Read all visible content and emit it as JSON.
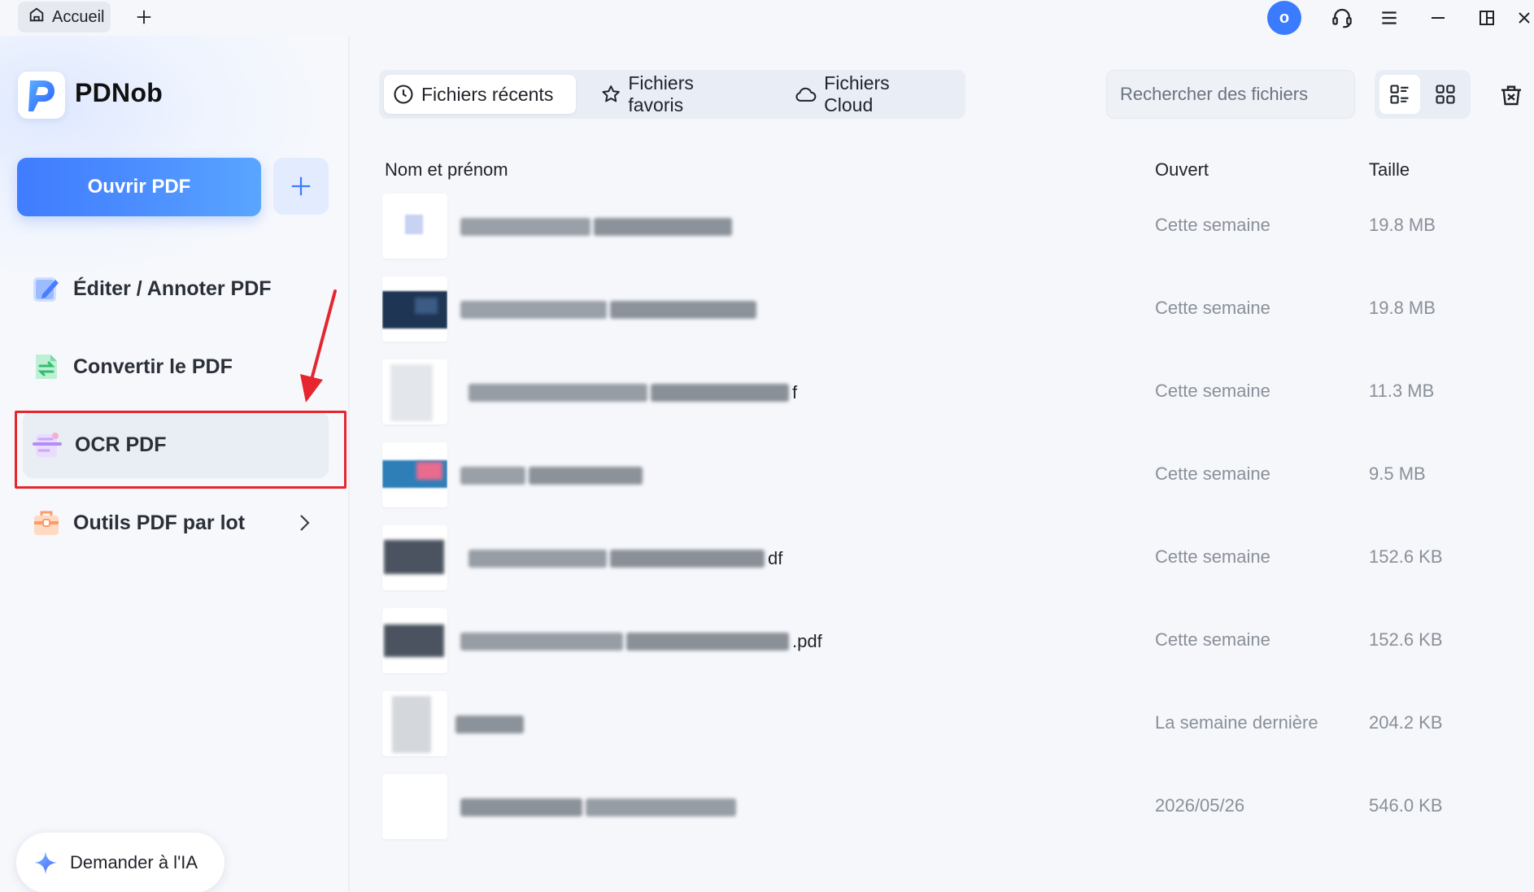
{
  "titlebar": {
    "home_tab": "Accueil",
    "avatar_letter": "o",
    "icons": [
      "home-icon",
      "plus-icon",
      "headset-icon",
      "menu-icon",
      "minimize-icon",
      "restore-icon",
      "close-icon"
    ]
  },
  "sidebar": {
    "app_name": "PDNob",
    "open_button": "Ouvrir PDF",
    "items": [
      {
        "label": "Éditer / Annoter PDF",
        "icon": "edit-icon"
      },
      {
        "label": "Convertir le PDF",
        "icon": "convert-icon"
      },
      {
        "label": "OCR PDF",
        "icon": "ocr-icon",
        "active": true
      },
      {
        "label": "Outils PDF par lot",
        "icon": "batch-icon"
      }
    ],
    "ask_ai": "Demander à l'IA"
  },
  "main": {
    "tabs": [
      {
        "label": "Fichiers récents",
        "icon": "clock-icon",
        "active": true
      },
      {
        "label": "Fichiers favoris",
        "icon": "star-icon"
      },
      {
        "label": "Fichiers Cloud",
        "icon": "cloud-icon"
      }
    ],
    "search_placeholder": "Rechercher des fichiers",
    "columns": {
      "name": "Nom et prénom",
      "opened": "Ouvert",
      "size": "Taille"
    },
    "files": [
      {
        "name_suffix": "",
        "opened": "Cette semaine",
        "size": "19.8 MB"
      },
      {
        "name_suffix": "",
        "opened": "Cette semaine",
        "size": "19.8 MB"
      },
      {
        "name_suffix": "f",
        "opened": "Cette semaine",
        "size": "11.3 MB"
      },
      {
        "name_suffix": "",
        "opened": "Cette semaine",
        "size": "9.5 MB"
      },
      {
        "name_suffix": "df",
        "opened": "Cette semaine",
        "size": "152.6 KB"
      },
      {
        "name_suffix": ".pdf",
        "opened": "Cette semaine",
        "size": "152.6 KB"
      },
      {
        "name_suffix": "",
        "opened": "La semaine dernière",
        "size": "204.2 KB"
      },
      {
        "name_suffix": "",
        "opened": "2026/05/26",
        "size": "546.0 KB"
      }
    ]
  },
  "colors": {
    "accent": "#3f7cff",
    "annotation": "#e5262e"
  }
}
